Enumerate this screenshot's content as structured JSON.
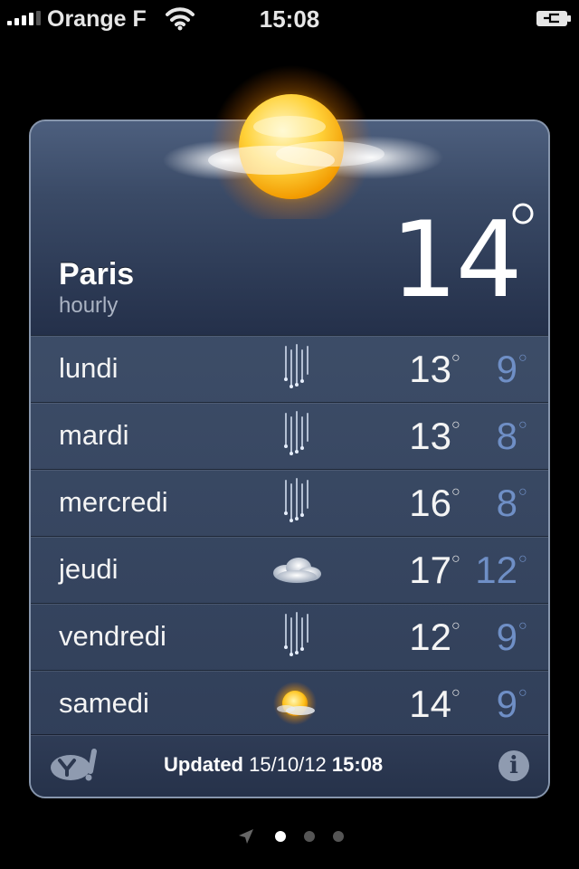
{
  "status_bar": {
    "carrier": "Orange F",
    "time": "15:08",
    "signal_bars": 4,
    "icons": [
      "signal-icon",
      "wifi-icon",
      "battery-charging-icon"
    ]
  },
  "weather": {
    "city": "Paris",
    "subtitle": "hourly",
    "current_temp": "14",
    "current_icon": "sunny-partly-cloudy-icon",
    "forecast": [
      {
        "day": "lundi",
        "icon": "rain-icon",
        "high": "13",
        "low": "9"
      },
      {
        "day": "mardi",
        "icon": "rain-icon",
        "high": "13",
        "low": "8"
      },
      {
        "day": "mercredi",
        "icon": "rain-icon",
        "high": "16",
        "low": "8"
      },
      {
        "day": "jeudi",
        "icon": "cloudy-icon",
        "high": "17",
        "low": "12"
      },
      {
        "day": "vendredi",
        "icon": "rain-icon",
        "high": "12",
        "low": "9"
      },
      {
        "day": "samedi",
        "icon": "partly-sunny-icon",
        "high": "14",
        "low": "9"
      }
    ]
  },
  "footer": {
    "updated_label": "Updated",
    "updated_date": "15/10/12",
    "updated_time": "15:08",
    "info_glyph": "i"
  },
  "pager": {
    "pages": 3,
    "current": 1
  },
  "colors": {
    "low_temp": "#6f8fc6",
    "card_border": "#8796ad"
  }
}
